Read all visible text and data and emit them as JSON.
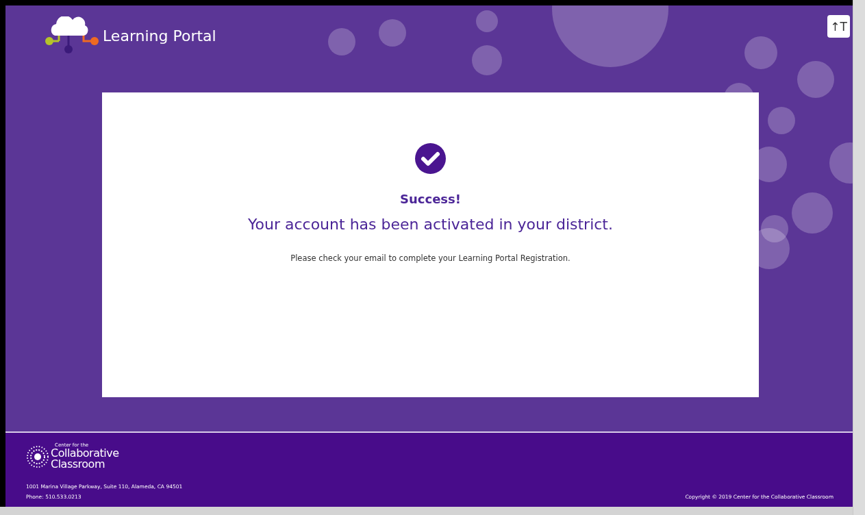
{
  "header": {
    "brand": "Learning Portal",
    "text_size_button": "↑T"
  },
  "message": {
    "title": "Success!",
    "heading": "Your account has been activated in your district.",
    "body": "Please check your email to complete your Learning Portal Registration."
  },
  "footer": {
    "logo_small": "Center for the",
    "logo_line_1": "Collaborative",
    "logo_line_2": "Classroom",
    "address": "1001 Marina Village Parkway, Suite 110, Alameda, CA 94501",
    "phone": "Phone: 510.533.0213",
    "copyright": "Copyright © 2019 Center for the Collaborative Classroom"
  }
}
